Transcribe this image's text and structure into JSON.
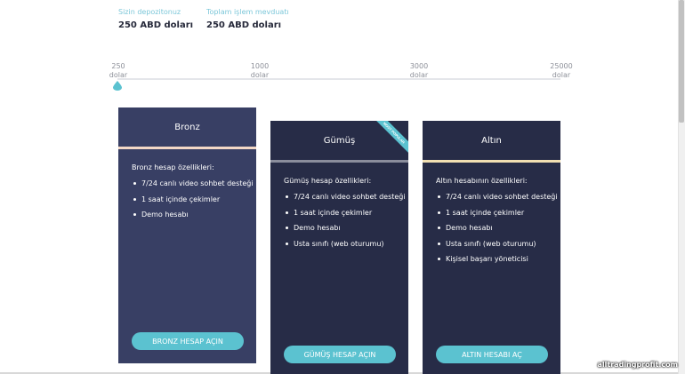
{
  "summary": {
    "deposit_label": "Sizin depozitonuz",
    "deposit_value": "250 ABD doları",
    "total_label": "Toplam işlem mevduatı",
    "total_value": "250 ABD doları"
  },
  "slider": {
    "ticks": [
      {
        "amount": "250",
        "unit": "dolar"
      },
      {
        "amount": "1000",
        "unit": "dolar"
      },
      {
        "amount": "3000",
        "unit": "dolar"
      },
      {
        "amount": "25000",
        "unit": "dolar"
      }
    ]
  },
  "plans": [
    {
      "name": "Bronz",
      "features_title": "Bronz hesap özellikleri:",
      "features": [
        "7/24 canlı video sohbet desteği",
        "1 saat içinde çekimler",
        "Demo hesabı"
      ],
      "button": "Bronz hesap açın",
      "bg": "#383f64",
      "sep": "#f3d8c6"
    },
    {
      "name": "Gümüş",
      "ribbon": "MOST POPULAR",
      "features_title": "Gümüş hesap özellikleri:",
      "features": [
        "7/24 canlı video sohbet desteği",
        "1 saat içinde çekimler",
        "Demo hesabı",
        "Usta sınıfı (web oturumu)"
      ],
      "button": "Gümüş hesap açın",
      "bg": "#272c47",
      "sep": "#8a8d9c"
    },
    {
      "name": "Altın",
      "features_title": "Altın hesabının özellikleri:",
      "features": [
        "7/24 canlı video sohbet desteği",
        "1 saat içinde çekimler",
        "Demo hesabı",
        "Usta sınıfı (web oturumu)",
        "Kişisel başarı yöneticisi"
      ],
      "button": "Altın hesabı aç",
      "bg": "#272c47",
      "sep": "#f1dfb2"
    }
  ],
  "watermark": "alltradingprofit.com",
  "colors": {
    "accent": "#5bc2d0",
    "label": "#7cc7d9",
    "text_dark": "#26293a"
  }
}
